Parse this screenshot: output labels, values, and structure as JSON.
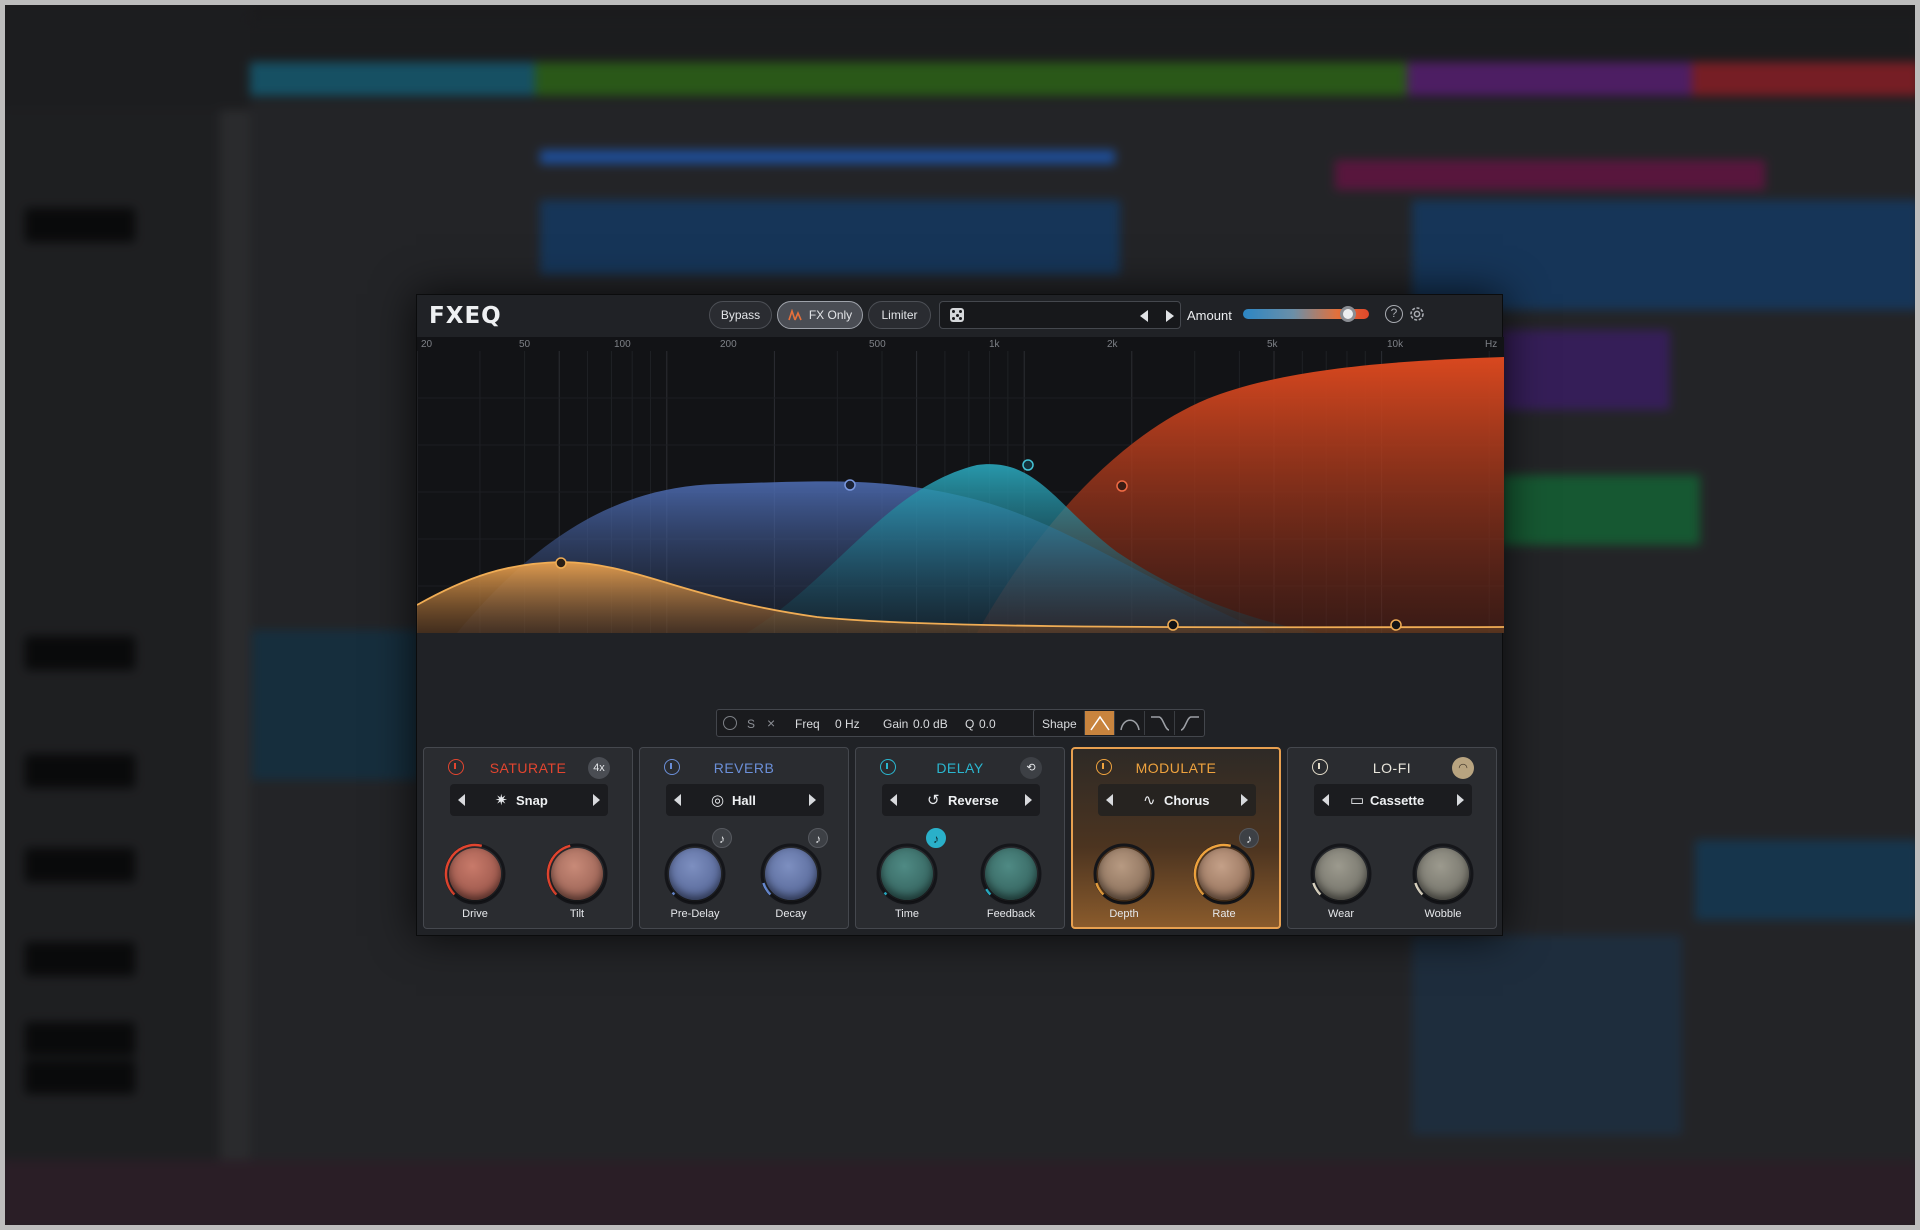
{
  "plugin": {
    "name": "FXEQ",
    "buttons": {
      "bypass": "Bypass",
      "fx_only": "FX Only",
      "limiter": "Limiter"
    },
    "amount_label": "Amount",
    "amount_value": 0.88,
    "help_icon": "?",
    "settings_icon": "gear-icon"
  },
  "eq": {
    "freq_labels": [
      "20",
      "50",
      "100",
      "200",
      "500",
      "1k",
      "2k",
      "5k",
      "10k",
      "Hz"
    ],
    "colors": {
      "orange": "#e8a04e",
      "blue": "#4f6fb8",
      "teal": "#2a9fb8",
      "red": "#d5461f"
    }
  },
  "bandbar": {
    "solo": "S",
    "close": "×",
    "freq_label": "Freq",
    "freq_value": "0 Hz",
    "gain_label": "Gain",
    "gain_value": "0.0 dB",
    "q_label": "Q",
    "q_value": "0.0",
    "shape_label": "Shape"
  },
  "modules": [
    {
      "title": "SATURATE",
      "color": "#e2452f",
      "badge": "4x",
      "preset": "Snap",
      "knobs": [
        "Drive",
        "Tilt"
      ],
      "knob_values": [
        0.55,
        0.45
      ]
    },
    {
      "title": "REVERB",
      "color": "#6b8fd8",
      "preset": "Hall",
      "knobs": [
        "Pre-Delay",
        "Decay"
      ],
      "knob_values": [
        0.0,
        0.1
      ]
    },
    {
      "title": "DELAY",
      "color": "#2ab6cf",
      "preset": "Reverse",
      "knobs": [
        "Time",
        "Feedback"
      ],
      "knob_values": [
        0.0,
        0.05
      ]
    },
    {
      "title": "MODULATE",
      "color": "#efa33e",
      "preset": "Chorus",
      "knobs": [
        "Depth",
        "Rate"
      ],
      "knob_values": [
        0.1,
        0.55
      ]
    },
    {
      "title": "LO-FI",
      "color": "#e2dbc8",
      "preset": "Cassette",
      "knobs": [
        "Wear",
        "Wobble"
      ],
      "knob_values": [
        0.1,
        0.1
      ]
    }
  ]
}
